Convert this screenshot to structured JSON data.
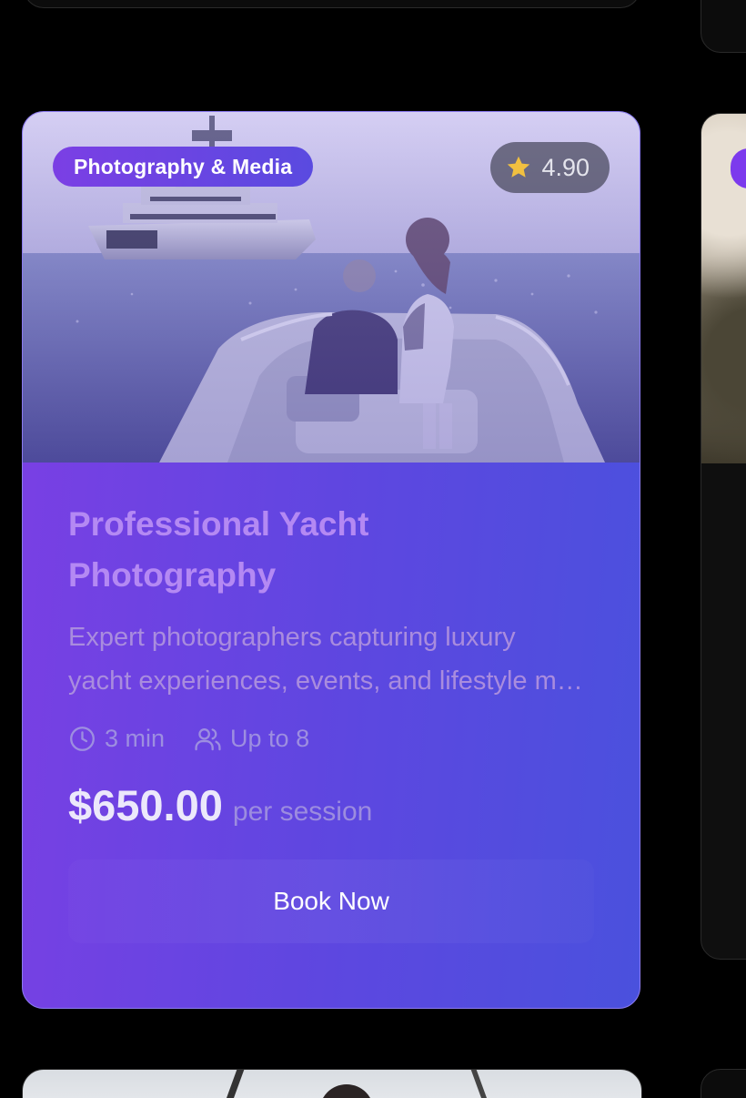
{
  "card": {
    "category": "Photography & Media",
    "rating": "4.90",
    "title": "Professional Yacht Photography",
    "description_line1": "Expert photographers capturing luxury",
    "description_line2": "yacht experiences, events, and lifestyle moments",
    "duration": "3 min",
    "capacity": "Up to 8",
    "price": "$650.00",
    "price_unit": "per session",
    "book_button": "Book Now"
  },
  "icons": {
    "rating": "star-icon",
    "duration": "clock-icon",
    "capacity": "users-icon"
  },
  "colors": {
    "accent_start": "#7b3fe4",
    "accent_end": "#4a51dd",
    "background": "#000000",
    "star": "#f1c040"
  }
}
